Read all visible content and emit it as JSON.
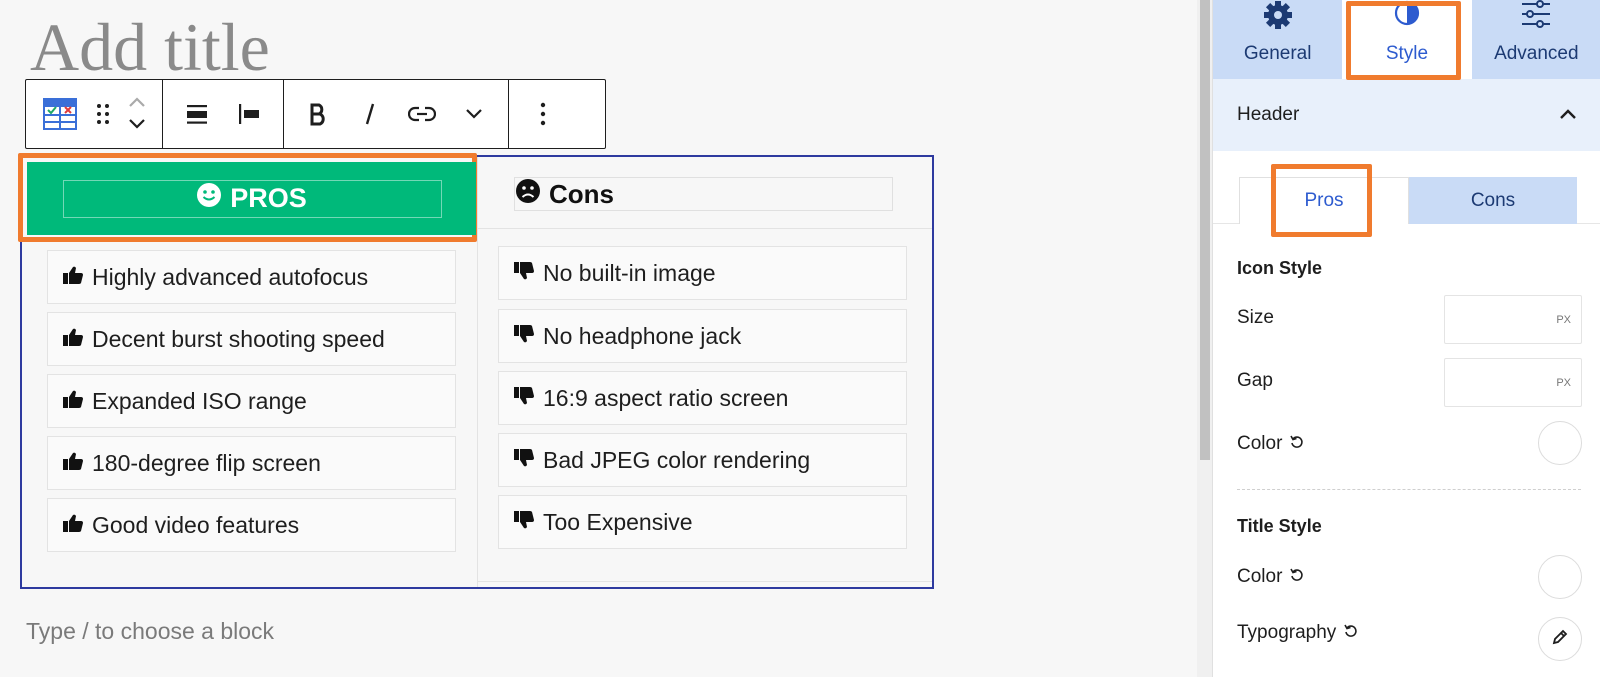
{
  "editor": {
    "post_title_placeholder": "Add title",
    "appender_placeholder": "Type / to choose a block"
  },
  "toolbar": {
    "icons": [
      "block-type-icon",
      "drag-handle-icon",
      "move-up-down-icon",
      "align-icon",
      "justify-left-icon",
      "bold-icon",
      "italic-icon",
      "link-icon",
      "more-formatting-chevron-icon",
      "options-icon"
    ]
  },
  "block": {
    "pros": {
      "title": "PROS",
      "header_color": "#00b97a",
      "items": [
        {
          "text": "Highly advanced autofocus"
        },
        {
          "text": "Decent burst shooting speed"
        },
        {
          "text": "Expanded ISO range"
        },
        {
          "text": "180-degree flip screen"
        },
        {
          "text": "Good video features"
        }
      ]
    },
    "cons": {
      "title": "Cons",
      "items": [
        {
          "text": "No built-in image"
        },
        {
          "text": "No headphone jack"
        },
        {
          "text": "16:9 aspect ratio screen"
        },
        {
          "text": "Bad JPEG color rendering"
        },
        {
          "text": "Too Expensive"
        }
      ]
    }
  },
  "sidebar": {
    "tabs": [
      {
        "label": "General",
        "icon": "gear-icon"
      },
      {
        "label": "Style",
        "icon": "half-circle-icon"
      },
      {
        "label": "Advanced",
        "icon": "sliders-icon"
      }
    ],
    "panel_title": "Header",
    "subtabs": [
      {
        "label": "Pros"
      },
      {
        "label": "Cons"
      }
    ],
    "icon_style": {
      "title": "Icon Style",
      "size_label": "Size",
      "size_unit": "PX",
      "gap_label": "Gap",
      "gap_unit": "PX",
      "color_label": "Color"
    },
    "title_style": {
      "title": "Title Style",
      "color_label": "Color",
      "typography_label": "Typography"
    }
  },
  "colors": {
    "accent_blue": "#2d5bcf",
    "tab_bg": "#c9dbf6",
    "highlight_orange": "#f07b2e",
    "block_border": "#2e3a9f"
  }
}
